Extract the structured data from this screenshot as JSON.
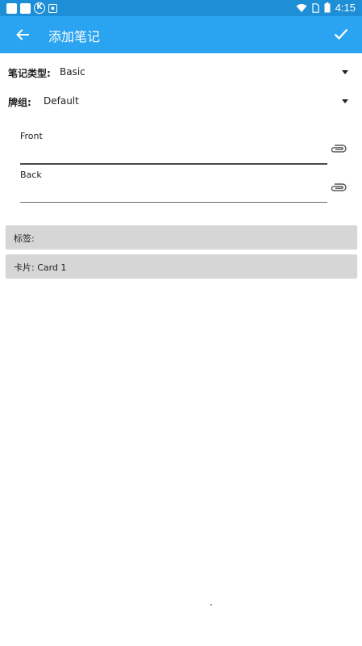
{
  "status_bar": {
    "time": "4:15",
    "icons": [
      "notification-square-icon",
      "notification-square-icon",
      "circle-k-icon",
      "small-app-icon",
      "wifi-icon",
      "sim-icon",
      "battery-icon"
    ],
    "background": "#1e8fd6"
  },
  "app_bar": {
    "title": "添加笔记",
    "background": "#2aa3f0",
    "back_icon": "arrow-left-icon",
    "confirm_icon": "check-icon"
  },
  "note_type": {
    "label": "笔记类型:",
    "value": "Basic"
  },
  "deck": {
    "label": "牌组:",
    "value": "Default"
  },
  "fields": [
    {
      "label": "Front",
      "value": ""
    },
    {
      "label": "Back",
      "value": ""
    }
  ],
  "tags_bar": {
    "label": "标签:"
  },
  "cards_bar": {
    "label": "卡片: Card 1"
  }
}
